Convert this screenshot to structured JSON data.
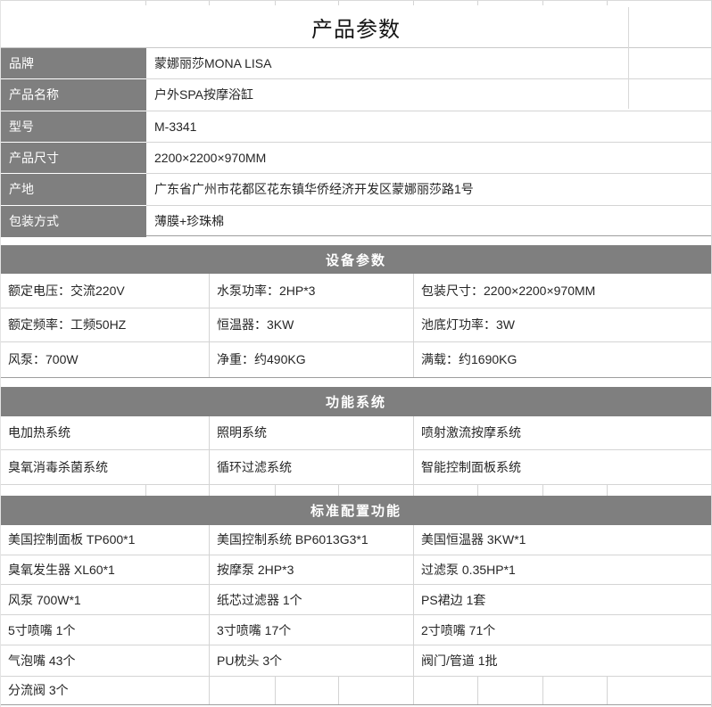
{
  "title": "产品参数",
  "colors": {
    "header_gray": "#7f7f7f",
    "grid_line": "#d4d4d4",
    "strong_line": "#9e9e9e",
    "header_text": "#ffffff",
    "body_text": "#262626"
  },
  "info": {
    "rows": [
      {
        "label": "品牌",
        "value": "蒙娜丽莎MONA LISA"
      },
      {
        "label": "产品名称",
        "value": "户外SPA按摩浴缸"
      },
      {
        "label": "型号",
        "value": "M-3341"
      },
      {
        "label": "产品尺寸",
        "value": "2200×2200×970MM"
      },
      {
        "label": "产地",
        "value": "广东省广州市花都区花东镇华侨经济开发区蒙娜丽莎路1号"
      },
      {
        "label": "包装方式",
        "value": "薄膜+珍珠棉"
      }
    ]
  },
  "sections": [
    {
      "header": "设备参数",
      "rows": [
        [
          "额定电压：交流220V",
          "水泵功率：2HP*3",
          "包装尺寸：2200×2200×970MM"
        ],
        [
          "额定频率：工频50HZ",
          "恒温器：3KW",
          "池底灯功率：3W"
        ],
        [
          "风泵：700W",
          "净重：约490KG",
          "满载：约1690KG"
        ]
      ]
    },
    {
      "header": "功能系统",
      "rows": [
        [
          "电加热系统",
          "照明系统",
          "喷射激流按摩系统"
        ],
        [
          "臭氧消毒杀菌系统",
          "循环过滤系统",
          "智能控制面板系统"
        ]
      ]
    },
    {
      "header": "标准配置功能",
      "rows": [
        [
          "美国控制面板 TP600*1",
          "美国控制系统 BP6013G3*1",
          "美国恒温器 3KW*1"
        ],
        [
          "臭氧发生器 XL60*1",
          "按摩泵 2HP*3",
          "过滤泵 0.35HP*1"
        ],
        [
          "风泵 700W*1",
          "纸芯过滤器 1个",
          "PS裙边 1套"
        ],
        [
          "5寸喷嘴 1个",
          "3寸喷嘴 17个",
          "2寸喷嘴 71个"
        ],
        [
          "气泡嘴 43个",
          "PU枕头 3个",
          "阀门/管道 1批"
        ]
      ],
      "tail_row": "分流阀 3个"
    }
  ]
}
